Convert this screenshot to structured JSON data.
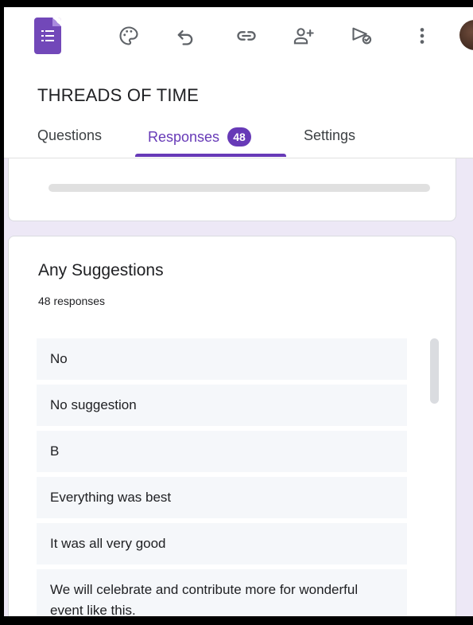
{
  "form": {
    "title": "THREADS OF TIME"
  },
  "toolbar": {
    "icons": [
      "forms-logo-icon",
      "palette-icon",
      "undo-icon",
      "link-icon",
      "add-collaborator-icon",
      "send-icon",
      "more-vert-icon",
      "avatar"
    ]
  },
  "tabs": [
    {
      "label": "Questions",
      "active": false
    },
    {
      "label": "Responses",
      "active": true,
      "badge": "48"
    },
    {
      "label": "Settings",
      "active": false
    }
  ],
  "colors": {
    "accent": "#673ab7",
    "background": "#ede8f6",
    "item_background": "#f5f7fa"
  },
  "question": {
    "title": "Any Suggestions",
    "response_count": "48 responses",
    "responses": [
      "No",
      "No suggestion",
      "B",
      "Everything was best",
      "It was all very good",
      "We will celebrate and contribute more for wonderful event like this."
    ]
  }
}
